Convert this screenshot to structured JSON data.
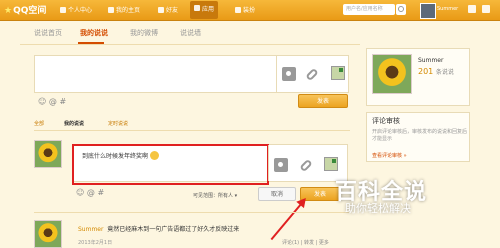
{
  "topbar": {
    "logo": "QQ空间",
    "nav": [
      "个人中心",
      "我的主页",
      "好友",
      "应用",
      "装扮"
    ],
    "search_placeholder": "用户名/应用名称",
    "user": "Summer"
  },
  "tabs": [
    "说说首页",
    "我的说说",
    "我的微博",
    "说说墙"
  ],
  "composer": {
    "publish": "发表"
  },
  "filters": {
    "all": "全部",
    "mine": "我的说说",
    "timed": "定时说说"
  },
  "reply": {
    "text": "到底什么时候发年终奖啊",
    "visibility_label": "可见范围：",
    "visibility_value": "所有人",
    "cancel": "取消",
    "publish": "发表"
  },
  "post": {
    "author": "Summer",
    "text": "竟然已经麻木到一句广告语都过了好久才反映过来",
    "date": "2013年2月1日",
    "actions": [
      "评论(1)",
      "转发",
      "更多"
    ]
  },
  "profile": {
    "name": "Summer",
    "count": "201",
    "count_label": "条说说"
  },
  "review": {
    "title": "评论审核",
    "desc": "开启评论审核后，审核发布的说说和回复后才能显示",
    "link": "查看评论审核"
  },
  "watermark": {
    "title": "百科全说",
    "sub": "助你轻松解决"
  }
}
